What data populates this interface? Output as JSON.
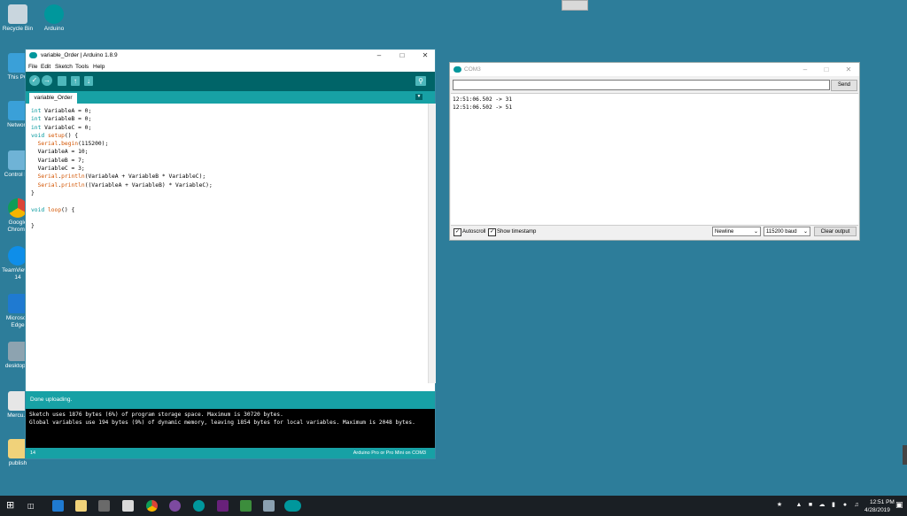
{
  "desktop": {
    "icons": [
      {
        "label": "Recycle Bin"
      },
      {
        "label": "Arduino"
      },
      {
        "label": "This PC"
      },
      {
        "label": "Network"
      },
      {
        "label": "Control Pa"
      },
      {
        "label": "Google Chrome"
      },
      {
        "label": "TeamViewer 14"
      },
      {
        "label": "Microsoft Edge"
      },
      {
        "label": "desktop..."
      },
      {
        "label": "Mercu..."
      },
      {
        "label": "publish"
      }
    ]
  },
  "ide": {
    "title": "variable_Order | Arduino 1.8.9",
    "menu": [
      "File",
      "Edit",
      "Sketch",
      "Tools",
      "Help"
    ],
    "tab": "variable_Order",
    "code": [
      [
        [
          "kw",
          "int"
        ],
        [
          "t",
          " VariableA = 0;"
        ]
      ],
      [
        [
          "kw",
          "int"
        ],
        [
          "t",
          " VariableB = 0;"
        ]
      ],
      [
        [
          "kw",
          "int"
        ],
        [
          "t",
          " VariableC = 0;"
        ]
      ],
      [
        [
          "kw",
          "void"
        ],
        [
          "t",
          " "
        ],
        [
          "fn",
          "setup"
        ],
        [
          "t",
          "() {"
        ]
      ],
      [
        [
          "t",
          "  "
        ],
        [
          "fn",
          "Serial"
        ],
        [
          "t",
          "."
        ],
        [
          "fn",
          "begin"
        ],
        [
          "t",
          "(115200);"
        ]
      ],
      [
        [
          "t",
          "  VariableA = 10;"
        ]
      ],
      [
        [
          "t",
          "  VariableB = 7;"
        ]
      ],
      [
        [
          "t",
          "  VariableC = 3;"
        ]
      ],
      [
        [
          "t",
          "  "
        ],
        [
          "fn",
          "Serial"
        ],
        [
          "t",
          "."
        ],
        [
          "fn",
          "println"
        ],
        [
          "t",
          "(VariableA + VariableB * VariableC);"
        ]
      ],
      [
        [
          "t",
          "  "
        ],
        [
          "fn",
          "Serial"
        ],
        [
          "t",
          "."
        ],
        [
          "fn",
          "println"
        ],
        [
          "t",
          "((VariableA + VariableB) * VariableC);"
        ]
      ],
      [
        [
          "t",
          "}"
        ]
      ],
      [
        [
          "t",
          ""
        ]
      ],
      [
        [
          "kw",
          "void"
        ],
        [
          "t",
          " "
        ],
        [
          "fn",
          "loop"
        ],
        [
          "t",
          "() {"
        ]
      ],
      [
        [
          "t",
          ""
        ]
      ],
      [
        [
          "t",
          "}"
        ]
      ]
    ],
    "status": "Done uploading.",
    "console": [
      "Sketch uses 1876 bytes (6%) of program storage space. Maximum is 30720 bytes.",
      "Global variables use 194 bytes (9%) of dynamic memory, leaving 1854 bytes for local variables. Maximum is 2048 bytes."
    ],
    "footer_line": "14",
    "footer_board": "Arduino Pro or Pro Mini on COM3"
  },
  "serial": {
    "title": "COM3",
    "send_label": "Send",
    "output": [
      "12:51:06.502 -> 31",
      "12:51:06.502 -> 51"
    ],
    "autoscroll_label": "Autoscroll",
    "timestamp_label": "Show timestamp",
    "line_ending": "Newline",
    "baud": "115200 baud",
    "clear_label": "Clear output"
  },
  "taskbar": {
    "time": "12:51 PM",
    "date": "4/28/2019"
  },
  "colors": {
    "desktop": "#2d7d9a",
    "arduino_teal": "#00979c",
    "arduino_dark": "#006468",
    "taskbar": "#1a1f24"
  }
}
